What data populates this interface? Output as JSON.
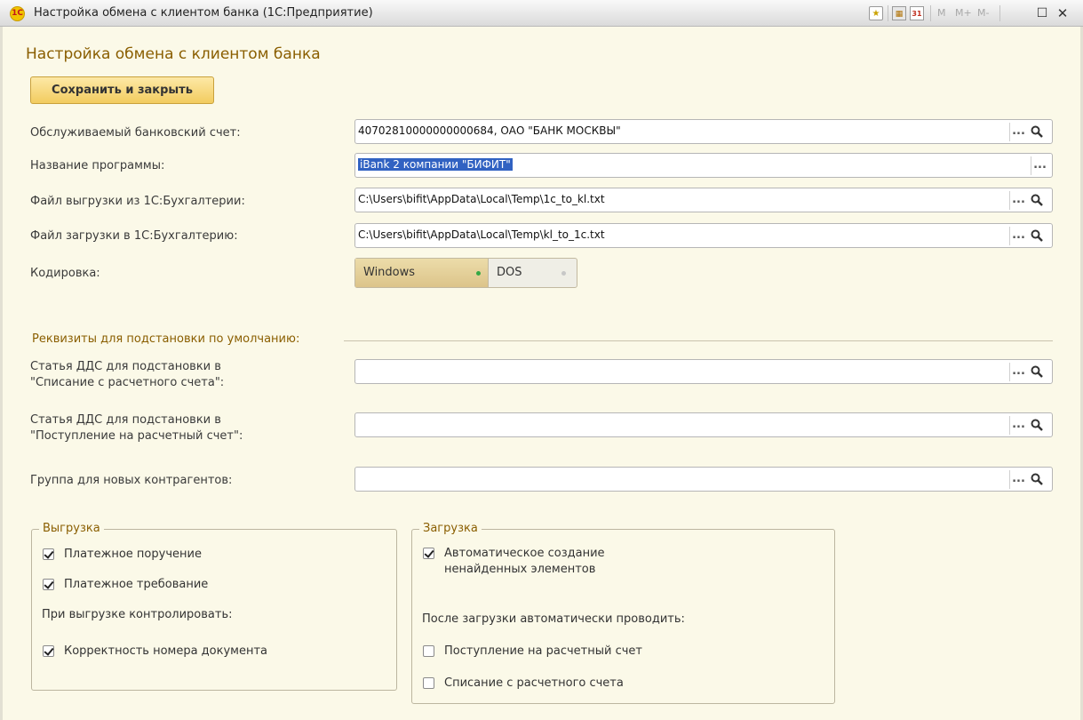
{
  "window": {
    "title": "Настройка обмена с клиентом банка  (1С:Предприятие)",
    "logo": "1С",
    "toolbar_m": "M",
    "toolbar_mplus": "M+",
    "toolbar_mminus": "M-",
    "toolbar_calendar": "31",
    "icons": [
      "favorite-icon",
      "calculator-icon",
      "calendar-icon",
      "maximize-icon",
      "close-icon"
    ]
  },
  "form": {
    "title": "Настройка обмена с клиентом банка",
    "save_button": "Сохранить и закрыть"
  },
  "fields": {
    "bank_account": {
      "label": "Обслуживаемый банковский счет:",
      "value": "40702810000000000684, ОАО \"БАНК МОСКВЫ\""
    },
    "program_name": {
      "label": "Название программы:",
      "value": "iBank 2 компании \"БИФИТ\""
    },
    "export_file": {
      "label": "Файл выгрузки из 1С:Бухгалтерии:",
      "value": "C:\\Users\\bifit\\AppData\\Local\\Temp\\1c_to_kl.txt"
    },
    "import_file": {
      "label": "Файл загрузки в 1С:Бухгалтерию:",
      "value": "C:\\Users\\bifit\\AppData\\Local\\Temp\\kl_to_1c.txt"
    },
    "encoding": {
      "label": "Кодировка:",
      "options": [
        "Windows",
        "DOS"
      ],
      "selected": "Windows"
    },
    "dots": "..."
  },
  "defaults": {
    "section_title": "Реквизиты для подстановки по умолчанию:",
    "cash_flow_writeoff_label_1": "Статья ДДС для подстановки в",
    "cash_flow_writeoff_label_2": "\"Списание с расчетного счета\":",
    "cash_flow_receipt_label_1": "Статья ДДС для подстановки в",
    "cash_flow_receipt_label_2": "\"Поступление на расчетный счет\":",
    "new_contractors_label": "Группа для новых контрагентов:"
  },
  "export_group": {
    "title": "Выгрузка",
    "payment_order": {
      "label": "Платежное поручение",
      "checked": true
    },
    "payment_request": {
      "label": "Платежное требование",
      "checked": true
    },
    "control_label": "При выгрузке контролировать:",
    "doc_number_check": {
      "label": "Корректность номера документа",
      "checked": true
    }
  },
  "import_group": {
    "title": "Загрузка",
    "auto_create": {
      "label_1": "Автоматическое создание",
      "label_2": "ненайденных элементов",
      "checked": true
    },
    "auto_post_label": "После загрузки автоматически проводить:",
    "receipt": {
      "label": "Поступление на расчетный счет",
      "checked": false
    },
    "writeoff": {
      "label": "Списание с расчетного счета",
      "checked": false
    }
  },
  "colors": {
    "background": "#fbf9e8",
    "accent": "#8a5e00",
    "button": "#f2cc5f",
    "selection": "#3162c2"
  }
}
